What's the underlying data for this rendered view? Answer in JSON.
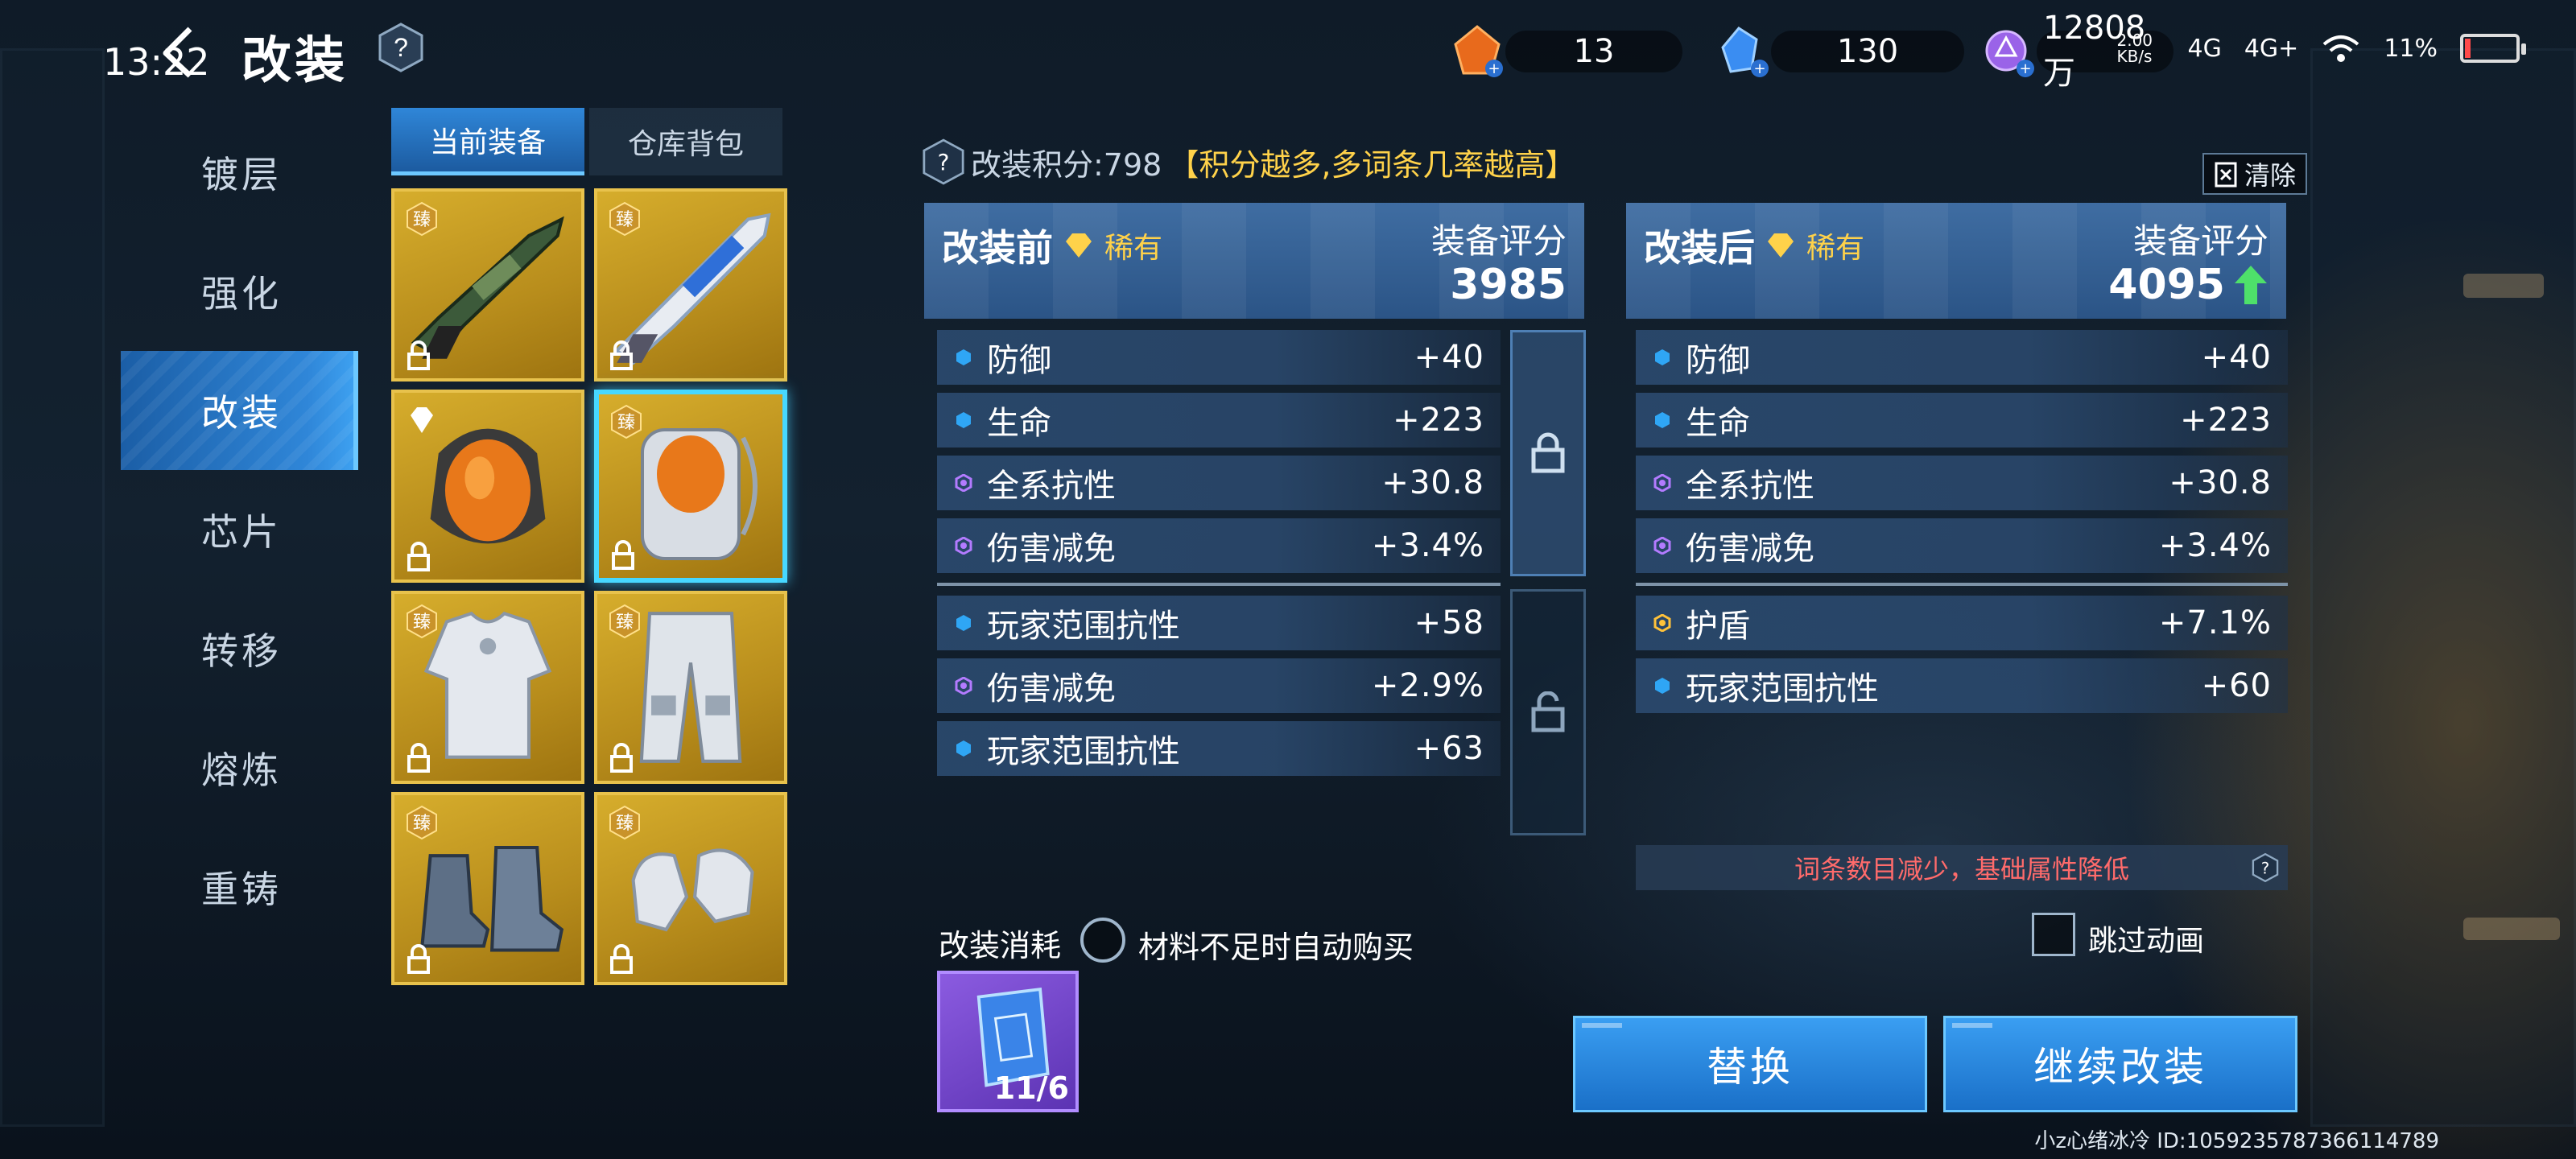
{
  "status_bar": {
    "time": "13:22",
    "net_speed": "2.00 KB/s",
    "network_1": "4G",
    "network_2": "4G+",
    "battery": "11%"
  },
  "header": {
    "title": "改装",
    "help": "?"
  },
  "currencies": [
    {
      "icon": "orange-crystal-icon",
      "value": "13",
      "color": "#e86a1c"
    },
    {
      "icon": "blue-gem-icon",
      "value": "130",
      "color": "#3a8df2"
    },
    {
      "icon": "purple-token-icon",
      "value": "12808万",
      "color": "#9a63e8"
    }
  ],
  "nav": {
    "items": [
      {
        "label": "镀层"
      },
      {
        "label": "强化"
      },
      {
        "label": "改装",
        "active": true
      },
      {
        "label": "芯片"
      },
      {
        "label": "转移"
      },
      {
        "label": "熔炼"
      },
      {
        "label": "重铸"
      }
    ]
  },
  "inventory": {
    "tabs": [
      {
        "label": "当前装备",
        "active": true
      },
      {
        "label": "仓库背包"
      }
    ],
    "badge_text": "臻",
    "slots": [
      {
        "item": "assault-rifle",
        "badge": "臻",
        "locked": true
      },
      {
        "item": "energy-rifle",
        "badge": "臻",
        "locked": true
      },
      {
        "item": "helmet",
        "badge": "gem",
        "locked": true
      },
      {
        "item": "backpack",
        "badge": "臻",
        "locked": true,
        "selected": true
      },
      {
        "item": "chest-armor",
        "badge": "臻",
        "locked": true
      },
      {
        "item": "leg-armor",
        "badge": "臻",
        "locked": true
      },
      {
        "item": "boots",
        "badge": "臻",
        "locked": true
      },
      {
        "item": "gloves",
        "badge": "臻",
        "locked": true
      }
    ]
  },
  "mod": {
    "points_label": "改装积分:798",
    "points_hint": "【积分越多,多词条几率越高】",
    "clear_label": "清除",
    "score_label": "装备评分",
    "rarity": "稀有",
    "before": {
      "title": "改装前",
      "score": "3985",
      "base_stats": [
        {
          "label": "防御",
          "value": "+40",
          "kind": "blue"
        },
        {
          "label": "生命",
          "value": "+223",
          "kind": "blue"
        },
        {
          "label": "全系抗性",
          "value": "+30.8",
          "kind": "purple"
        },
        {
          "label": "伤害减免",
          "value": "+3.4%",
          "kind": "purple"
        }
      ],
      "extra_stats": [
        {
          "label": "玩家范围抗性",
          "value": "+58",
          "kind": "blue"
        },
        {
          "label": "伤害减免",
          "value": "+2.9%",
          "kind": "purple"
        },
        {
          "label": "玩家范围抗性",
          "value": "+63",
          "kind": "blue"
        }
      ]
    },
    "after": {
      "title": "改装后",
      "score": "4095",
      "base_stats": [
        {
          "label": "防御",
          "value": "+40",
          "kind": "blue"
        },
        {
          "label": "生命",
          "value": "+223",
          "kind": "blue"
        },
        {
          "label": "全系抗性",
          "value": "+30.8",
          "kind": "purple"
        },
        {
          "label": "伤害减免",
          "value": "+3.4%",
          "kind": "purple"
        }
      ],
      "extra_stats": [
        {
          "label": "护盾",
          "value": "+7.1%",
          "kind": "gold"
        },
        {
          "label": "玩家范围抗性",
          "value": "+60",
          "kind": "blue"
        }
      ]
    },
    "warning": "词条数目减少，基础属性降低"
  },
  "cost": {
    "label": "改装消耗",
    "auto_buy_label": "材料不足时自动购买",
    "material_count": "11/6",
    "skip_anim_label": "跳过动画"
  },
  "actions": {
    "replace_label": "替换",
    "continue_label": "继续改装"
  },
  "footer": {
    "uid": "小z心绪冰冷  ID:1059235787366114789"
  },
  "colors": {
    "accent": "#2f86d8",
    "rarity_gold": "#ffd24a",
    "up_arrow": "#4ee06a",
    "warning": "#ff6b6b"
  }
}
